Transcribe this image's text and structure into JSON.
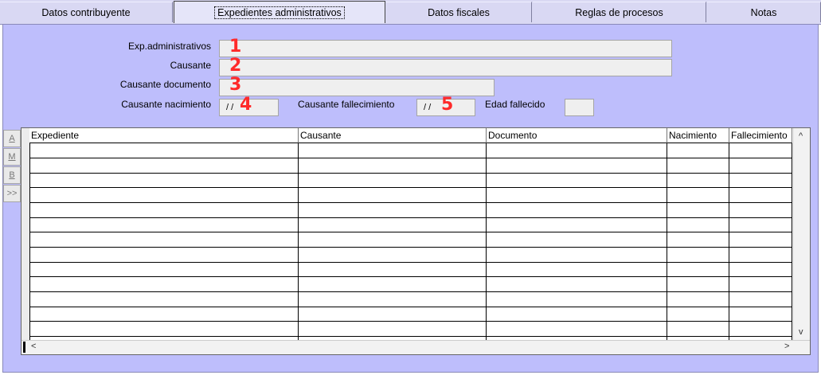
{
  "tabs": [
    {
      "label": "Datos contribuyente"
    },
    {
      "label": "Expedientes administrativos"
    },
    {
      "label": "Datos fiscales"
    },
    {
      "label": "Reglas de procesos"
    },
    {
      "label": "Notas"
    }
  ],
  "form": {
    "exp_label": "Exp.administrativos",
    "causante_label": "Causante",
    "causante_doc_label": "Causante documento",
    "nacimiento_label": "Causante nacimiento",
    "nacimiento_value": "/ /",
    "fallecimiento_label": "Causante fallecimiento",
    "fallecimiento_value": "/ /",
    "edad_label": "Edad fallecido"
  },
  "annotations": [
    "1",
    "2",
    "3",
    "4",
    "5"
  ],
  "side_buttons": [
    "A",
    "M",
    "B",
    ">>"
  ],
  "table": {
    "columns": [
      "Expediente",
      "Causante",
      "Documento",
      "Nacimiento",
      "Fallecimiento"
    ]
  },
  "scroll": {
    "up": "^",
    "down": "v",
    "left": "<",
    "right": ">"
  },
  "colors": {
    "panel": "#bebefc",
    "tabs": "#d9d8f3",
    "annotation": "#ff2a2a"
  }
}
